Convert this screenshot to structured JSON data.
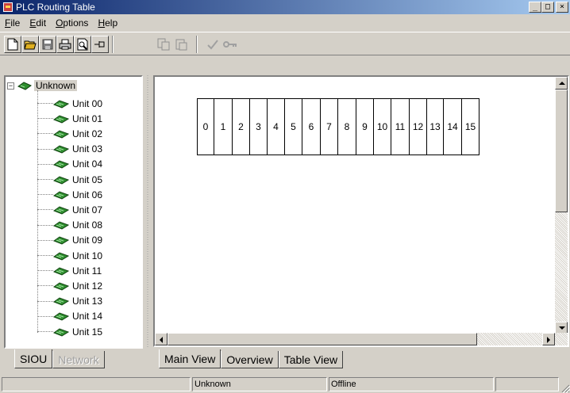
{
  "window": {
    "title": "PLC Routing Table",
    "controls": [
      "_",
      "□",
      "×"
    ]
  },
  "menu": [
    {
      "label": "File",
      "mnemonic": "F",
      "rest": "ile"
    },
    {
      "label": "Edit",
      "mnemonic": "E",
      "rest": "dit"
    },
    {
      "label": "Options",
      "mnemonic": "O",
      "rest": "ptions"
    },
    {
      "label": "Help",
      "mnemonic": "H",
      "rest": "elp"
    }
  ],
  "toolbar": {
    "buttons": [
      "new-icon",
      "open-icon",
      "save-icon",
      "print-icon",
      "print-preview-icon",
      "pin-icon",
      "copy-icon",
      "paste-icon",
      "check-icon",
      "key-icon"
    ]
  },
  "tree": {
    "root": {
      "label": "Unknown",
      "expander": "−"
    },
    "items": [
      "Unit 00",
      "Unit 01",
      "Unit 02",
      "Unit 03",
      "Unit 04",
      "Unit 05",
      "Unit 06",
      "Unit 07",
      "Unit 08",
      "Unit 09",
      "Unit 10",
      "Unit 11",
      "Unit 12",
      "Unit 13",
      "Unit 14",
      "Unit 15"
    ]
  },
  "slots": [
    "0",
    "1",
    "2",
    "3",
    "4",
    "5",
    "6",
    "7",
    "8",
    "9",
    "10",
    "11",
    "12",
    "13",
    "14",
    "15"
  ],
  "left_tabs": [
    {
      "label": "SIOU",
      "state": "active"
    },
    {
      "label": "Network",
      "state": "disabled"
    }
  ],
  "main_tabs": [
    {
      "label": "Main View",
      "state": "active"
    },
    {
      "label": "Overview",
      "state": "normal"
    },
    {
      "label": "Table View",
      "state": "normal"
    }
  ],
  "status": {
    "plc": "Unknown",
    "mode": "Offline"
  }
}
